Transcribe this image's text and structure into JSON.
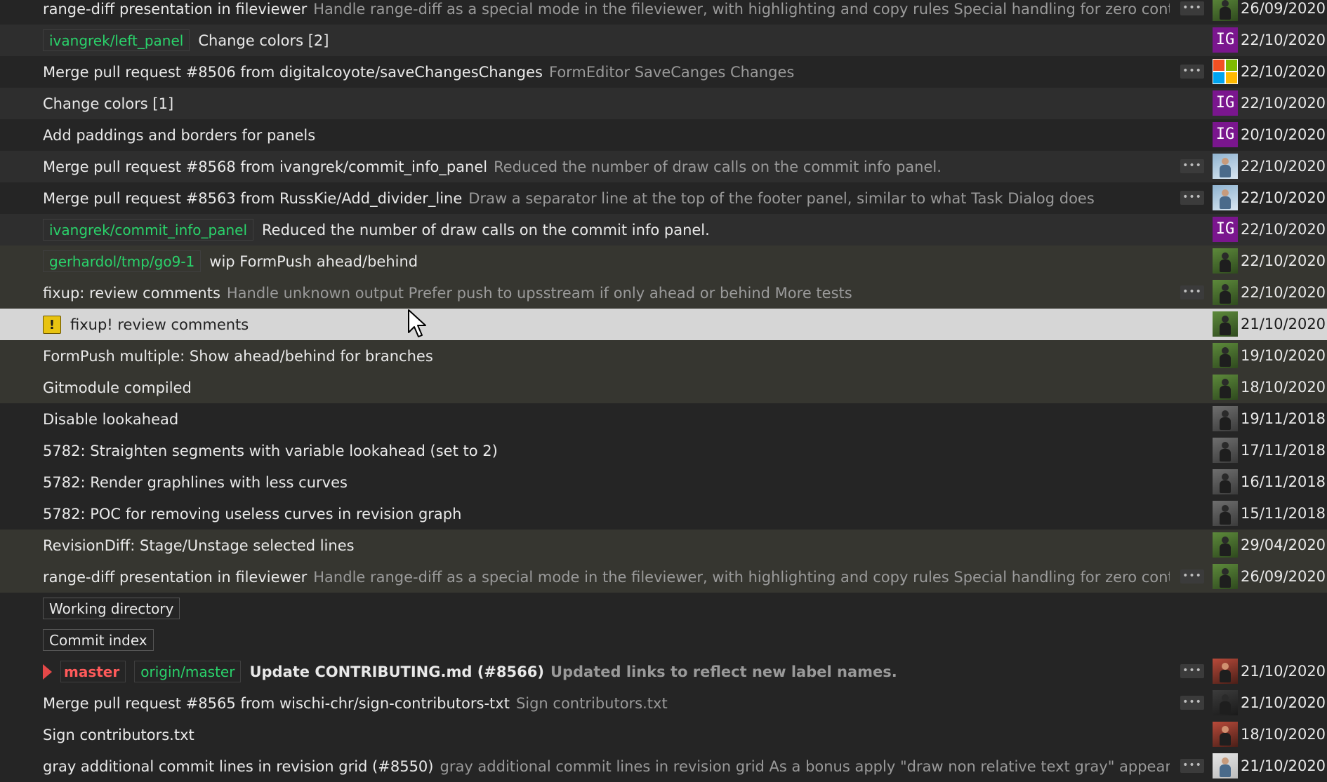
{
  "rows": [
    {
      "message": "range-diff presentation in fileviewer",
      "desc": "Handle range-diff as a special mode in the fileviewer, with highlighting and copy rules Special handling for zero context lines Show t...",
      "more": "•••",
      "avatar": "photo-green",
      "date": "26/09/2020 1",
      "style": ""
    },
    {
      "refs": [
        {
          "label": "ivangrek/left_panel",
          "type": "remote"
        }
      ],
      "message": "Change colors [2]",
      "avatar": "initials",
      "initials": "IG",
      "date": "22/10/2020 2",
      "style": "alt"
    },
    {
      "message": "Merge pull request #8506 from digitalcoyote/saveChangesChanges",
      "desc": "FormEditor SaveCanges Changes",
      "more": "•••",
      "avatar": "microsoft",
      "date": "22/10/2020 2",
      "style": ""
    },
    {
      "message": "Change colors [1]",
      "avatar": "initials",
      "initials": "IG",
      "date": "22/10/2020 2",
      "style": "alt"
    },
    {
      "message": "Add paddings and borders for panels",
      "avatar": "initials",
      "initials": "IG",
      "date": "20/10/2020 0",
      "style": ""
    },
    {
      "message": "Merge pull request #8568 from ivangrek/commit_info_panel",
      "desc": "Reduced the number of draw calls on the commit info panel.",
      "more": "•••",
      "avatar": "photo-blue",
      "date": "22/10/2020 0",
      "style": "alt"
    },
    {
      "message": "Merge pull request #8563 from RussKie/Add_divider_line",
      "desc": "Draw a separator line at the top of the footer panel, similar to what Task Dialog does",
      "more": "•••",
      "avatar": "photo-blue",
      "date": "22/10/2020 0",
      "style": ""
    },
    {
      "refs": [
        {
          "label": "ivangrek/commit_info_panel",
          "type": "remote"
        }
      ],
      "message": "Reduced the number of draw calls on the commit info panel.",
      "avatar": "initials",
      "initials": "IG",
      "date": "22/10/2020 0",
      "style": "alt"
    },
    {
      "refs": [
        {
          "label": "gerhardol/tmp/go9-1",
          "type": "remote"
        }
      ],
      "message": "wip FormPush ahead/behind",
      "avatar": "photo-green",
      "date": "22/10/2020 0",
      "style": "hl"
    },
    {
      "message": "fixup: review comments",
      "desc": "Handle unknown output Prefer push to upsstream if only ahead or behind More tests",
      "more": "•••",
      "avatar": "photo-green",
      "date": "22/10/2020 0",
      "style": "hl"
    },
    {
      "warn": "!",
      "message": "fixup! review comments",
      "avatar": "photo-green",
      "date": "21/10/2020 0",
      "style": "sel"
    },
    {
      "message": "FormPush multiple: Show ahead/behind for branches",
      "avatar": "photo-green",
      "date": "19/10/2020 2",
      "style": "hl"
    },
    {
      "message": "Gitmodule compiled",
      "avatar": "photo-green",
      "date": "18/10/2020 2",
      "style": "hl"
    },
    {
      "message": "Disable lookahead",
      "avatar": "photo-gray",
      "date": "19/11/2018 1",
      "style": ""
    },
    {
      "message": "5782: Straighten segments with variable lookahead (set to 2)",
      "avatar": "photo-gray",
      "date": "17/11/2018 1",
      "style": ""
    },
    {
      "message": "5782: Render graphlines with less curves",
      "avatar": "photo-gray",
      "date": "16/11/2018 1",
      "style": ""
    },
    {
      "message": "5782: POC for removing useless curves in revision graph",
      "avatar": "photo-gray",
      "date": "15/11/2018 1",
      "style": ""
    },
    {
      "message": "RevisionDiff: Stage/Unstage selected lines",
      "avatar": "photo-green",
      "date": "29/04/2020 1",
      "style": "hl"
    },
    {
      "message": "range-diff presentation in fileviewer",
      "desc": "Handle range-diff as a special mode in the fileviewer, with highlighting and copy rules Special handling for zero context lines Show t...",
      "more": "•••",
      "avatar": "photo-green",
      "date": "26/09/2020 1",
      "style": "hl"
    },
    {
      "refs": [
        {
          "label": "Working directory",
          "type": "box"
        }
      ],
      "message": "",
      "style": ""
    },
    {
      "refs": [
        {
          "label": "Commit index",
          "type": "box"
        }
      ],
      "message": "",
      "style": ""
    },
    {
      "refs": [
        {
          "label": "master",
          "type": "local"
        },
        {
          "label": "origin/master",
          "type": "remote"
        }
      ],
      "message": "Update CONTRIBUTING.md (#8566)",
      "desc": "Updated links to reflect new label names.",
      "bold": true,
      "more": "•••",
      "avatar": "photo-red",
      "date": "21/10/2020 2",
      "style": ""
    },
    {
      "message": "Merge pull request #8565 from wischi-chr/sign-contributors-txt",
      "desc": "Sign contributors.txt",
      "more": "•••",
      "avatar": "photo-dark",
      "date": "21/10/2020 2",
      "style": ""
    },
    {
      "message": "Sign contributors.txt",
      "avatar": "photo-red",
      "date": "18/10/2020 0",
      "style": ""
    },
    {
      "message": "gray additional commit lines in revision grid (#8550)",
      "desc": "gray additional commit lines in revision grid  As a bonus apply \"draw non relative text gray\" appearance setting to s...",
      "more": "•••",
      "avatar": "photo-light",
      "date": "21/10/2020 1",
      "style": ""
    }
  ]
}
